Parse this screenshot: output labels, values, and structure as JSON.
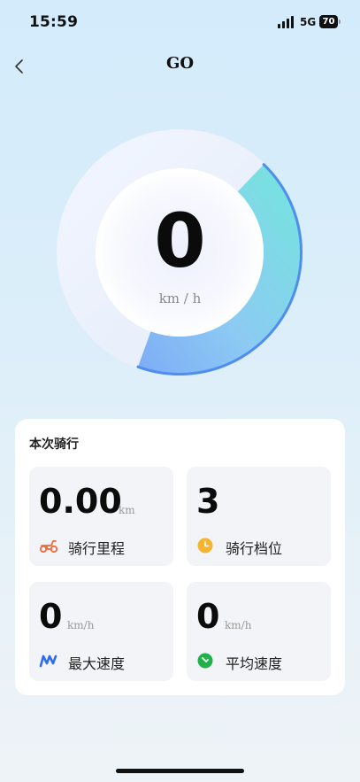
{
  "status_bar": {
    "time": "15:59",
    "network": "5G",
    "battery": "70"
  },
  "header": {
    "title": "GO",
    "back_icon": "chevron-left-icon"
  },
  "speedometer": {
    "value": "0",
    "unit": "km / h",
    "progress_fraction": 0.28,
    "accent_start": "#5fe4d6",
    "accent_end": "#6aa0f5"
  },
  "ride_summary": {
    "title": "本次骑行",
    "stats": [
      {
        "value": "0.00",
        "unit": "km",
        "label": "骑行里程",
        "icon": "scooter-icon",
        "icon_color": "#f06a3a"
      },
      {
        "value": "3",
        "unit": "",
        "label": "骑行档位",
        "icon": "clock-icon",
        "icon_color": "#f5b533"
      },
      {
        "value": "0",
        "unit": "km/h",
        "label": "最大速度",
        "icon": "max-speed-icon",
        "icon_color": "#2f6cf0"
      },
      {
        "value": "0",
        "unit": "km/h",
        "label": "平均速度",
        "icon": "gauge-icon",
        "icon_color": "#22b04a"
      }
    ]
  }
}
